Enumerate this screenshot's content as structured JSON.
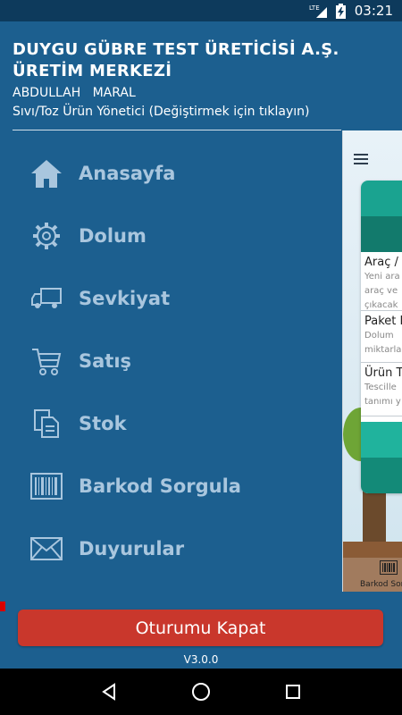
{
  "status_bar": {
    "network": "LTE",
    "time": "03:21",
    "icons": [
      "lte-signal-icon",
      "battery-charging-icon"
    ]
  },
  "header": {
    "company": "DUYGU GÜBRE TEST ÜRETİCİSİ A.Ş. ÜRETİM MERKEZİ",
    "user_first": "ABDULLAH",
    "user_last": "MARAL",
    "role": "Sıvı/Toz Ürün Yönetici (Değiştirmek için tıklayın)"
  },
  "menu": {
    "items": [
      {
        "label": "Anasayfa",
        "icon": "home-icon"
      },
      {
        "label": "Dolum",
        "icon": "gear-icon"
      },
      {
        "label": "Sevkiyat",
        "icon": "truck-icon"
      },
      {
        "label": "Satış",
        "icon": "cart-icon"
      },
      {
        "label": "Stok",
        "icon": "documents-icon"
      },
      {
        "label": "Barkod Sorgula",
        "icon": "barcode-icon"
      },
      {
        "label": "Duyurular",
        "icon": "envelope-icon"
      }
    ]
  },
  "preview": {
    "items": [
      {
        "title": "Araç / S",
        "lines": [
          "Yeni ara",
          "araç ve",
          "çıkacak"
        ]
      },
      {
        "title": "Paket D",
        "lines": [
          "Dolum",
          "miktarla"
        ]
      },
      {
        "title": "Ürün T",
        "lines": [
          "Tescille",
          "tanımı y"
        ]
      }
    ],
    "tab_label": "Barkod Sor"
  },
  "footer": {
    "logout_label": "Oturumu Kapat",
    "version": "V3.0.0"
  },
  "colors": {
    "drawer_bg": "#1c5f8f",
    "menu_text": "#a9c6de",
    "logout_bg": "#c9372c",
    "status_bg": "#0d3a5c"
  }
}
